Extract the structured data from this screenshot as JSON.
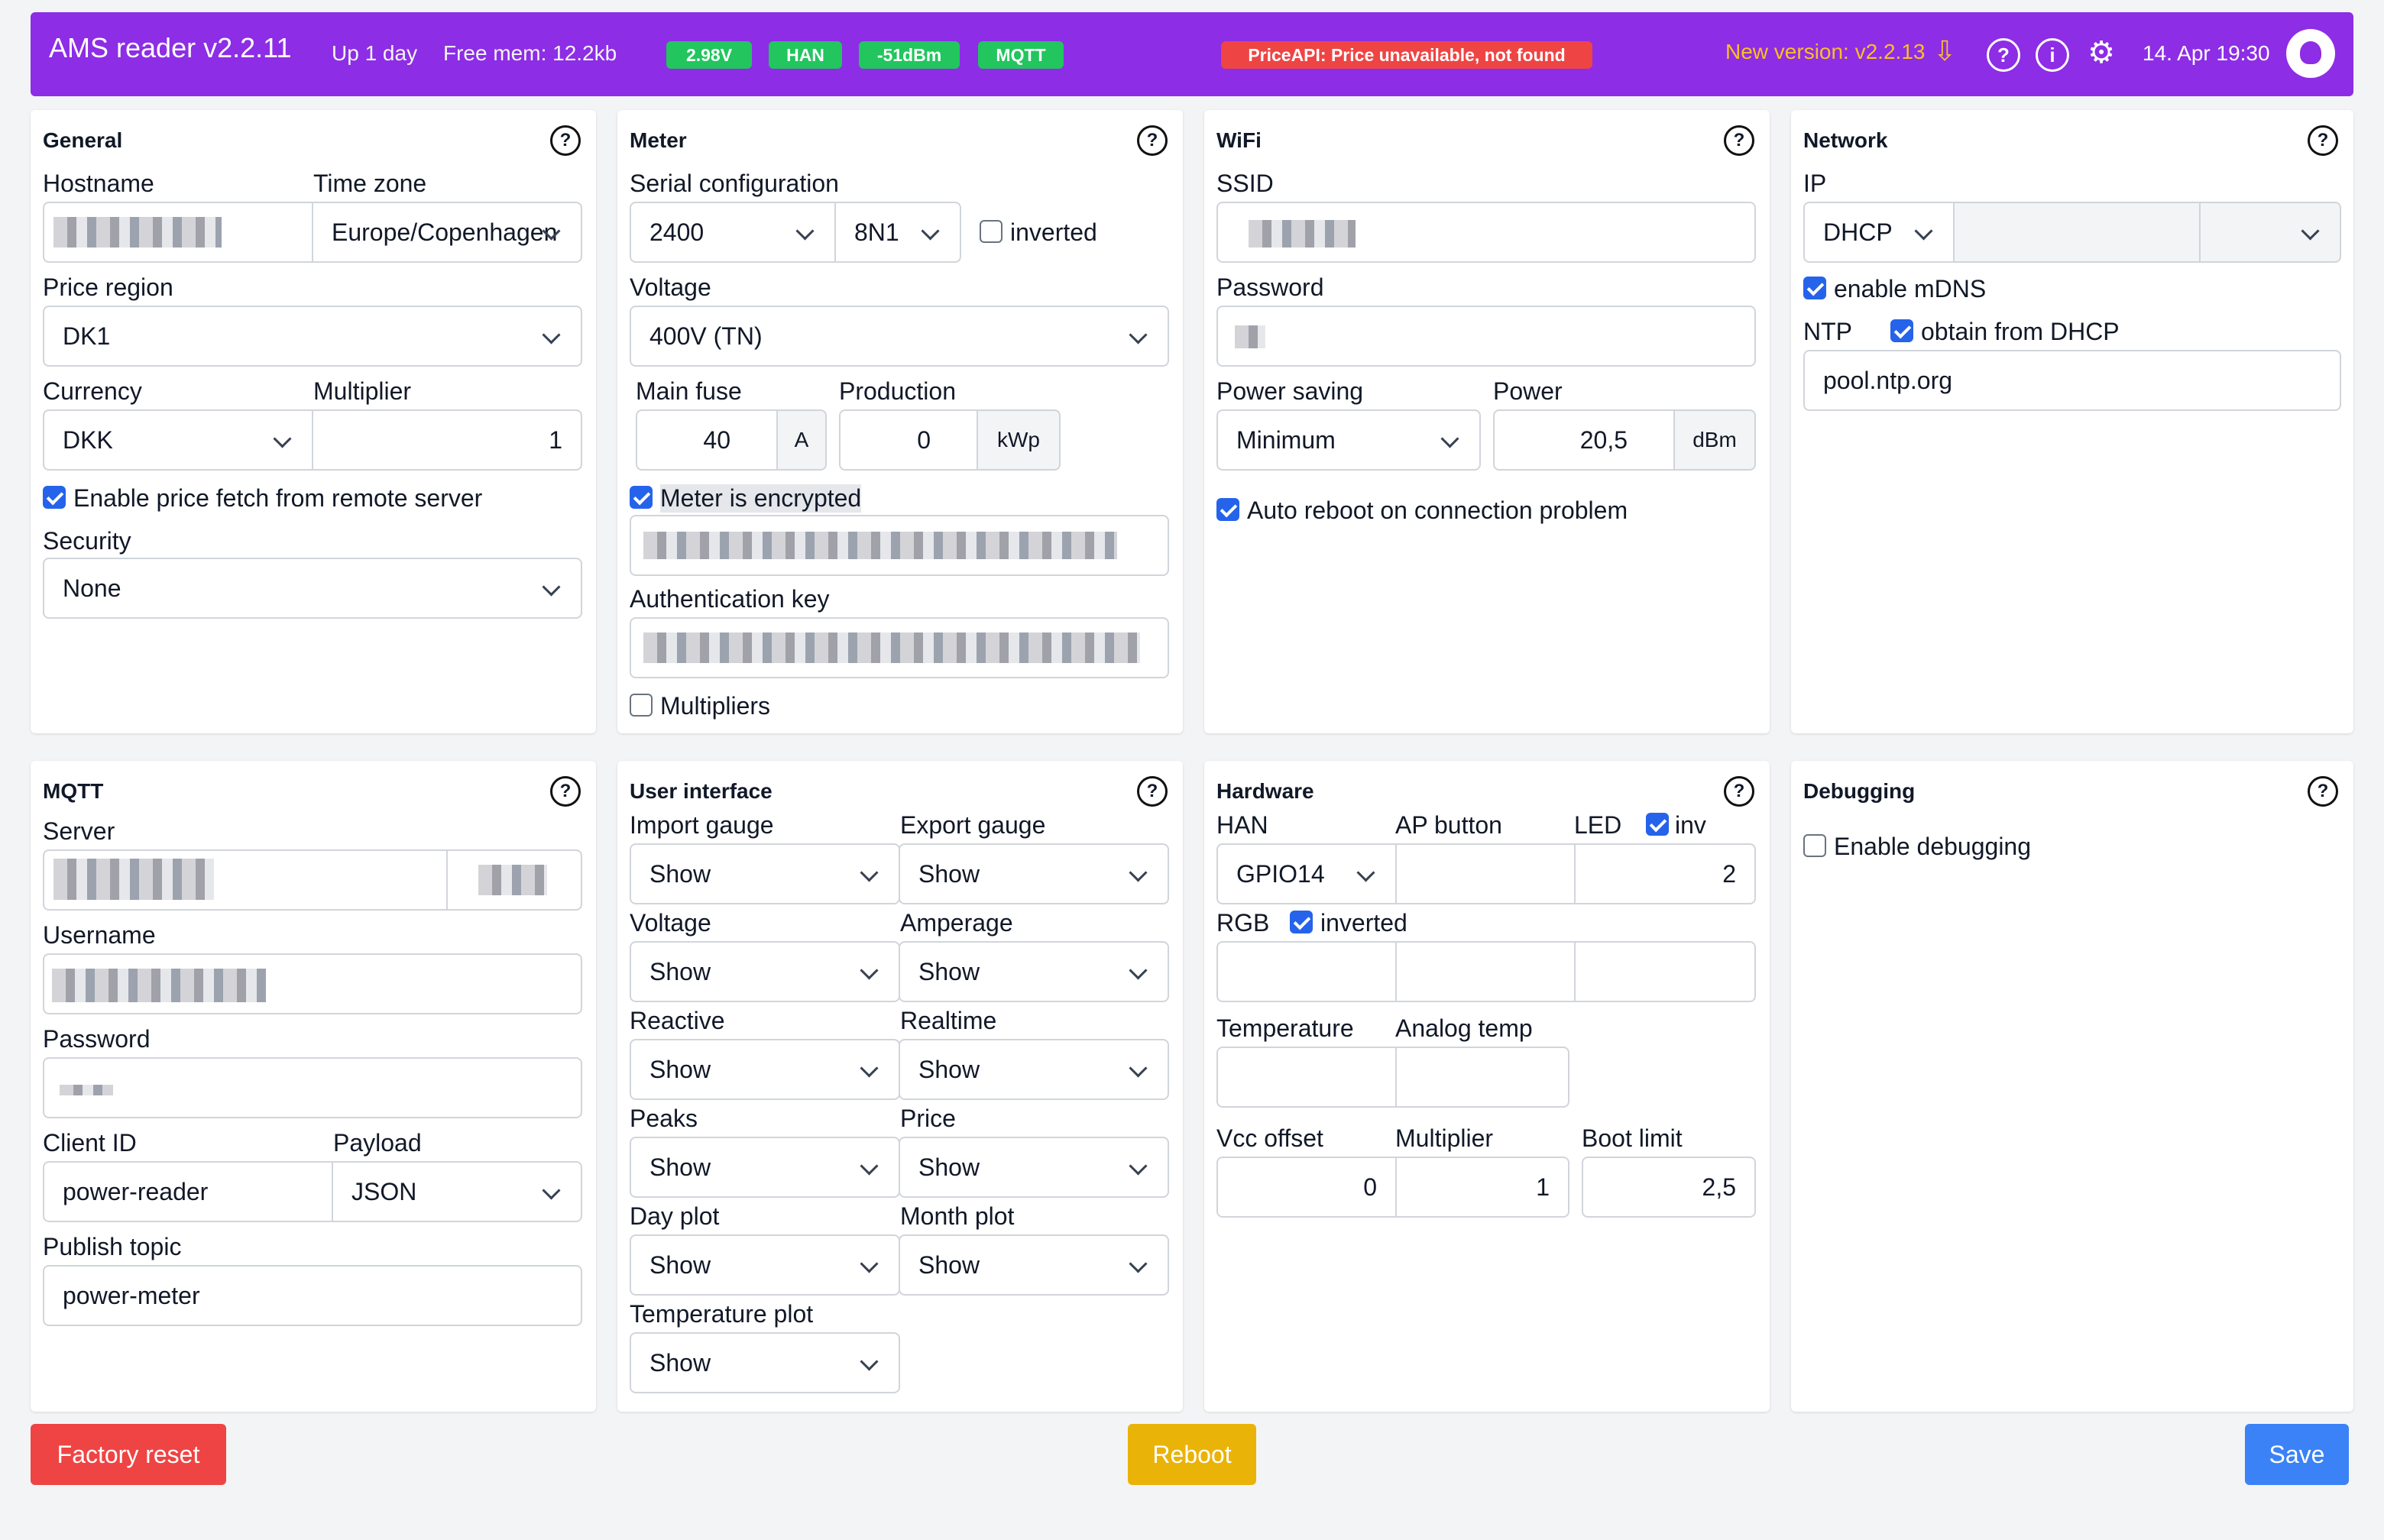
{
  "header": {
    "title": "AMS reader v2.2.11",
    "uptime": "Up 1 day",
    "free_mem": "Free mem: 12.2kb",
    "badges": [
      "2.98V",
      "HAN",
      "-51dBm",
      "MQTT"
    ],
    "error": "PriceAPI: Price unavailable, not found",
    "new_version": "New version: v2.2.13",
    "datetime": "14. Apr 19:30",
    "help_glyph": "?",
    "info_glyph": "i",
    "gear_glyph": "⚙",
    "download_glyph": "⇩",
    "colors": {
      "bar": "#8d2de5",
      "badge_ok": "#22c55e",
      "badge_err": "#ef4444",
      "new_version": "#fbbf24"
    }
  },
  "general": {
    "title": "General",
    "hostname_label": "Hostname",
    "timezone_label": "Time zone",
    "timezone": "Europe/Copenhagen",
    "price_region_label": "Price region",
    "price_region": "DK1",
    "currency_label": "Currency",
    "currency": "DKK",
    "multiplier_label": "Multiplier",
    "multiplier": "1",
    "price_fetch_label": "Enable price fetch from remote server",
    "security_label": "Security",
    "security": "None"
  },
  "meter": {
    "title": "Meter",
    "serial_label": "Serial configuration",
    "baud": "2400",
    "parity": "8N1",
    "inverted_label": "inverted",
    "voltage_label": "Voltage",
    "voltage": "400V (TN)",
    "main_fuse_label": "Main fuse",
    "main_fuse": "40",
    "main_fuse_unit": "A",
    "production_label": "Production",
    "production": "0",
    "production_unit": "kWp",
    "encrypted_label": "Meter is encrypted",
    "auth_key_label": "Authentication key",
    "multipliers_label": "Multipliers"
  },
  "wifi": {
    "title": "WiFi",
    "ssid_label": "SSID",
    "password_label": "Password",
    "power_saving_label": "Power saving",
    "power_saving": "Minimum",
    "power_label": "Power",
    "power": "20,5",
    "power_unit": "dBm",
    "auto_reboot_label": "Auto reboot on connection problem"
  },
  "network": {
    "title": "Network",
    "ip_label": "IP",
    "ip_mode": "DHCP",
    "mdns_label": "enable mDNS",
    "ntp_label": "NTP",
    "ntp_dhcp_label": "obtain from DHCP",
    "ntp_server": "pool.ntp.org"
  },
  "mqtt": {
    "title": "MQTT",
    "server_label": "Server",
    "username_label": "Username",
    "password_label": "Password",
    "client_id_label": "Client ID",
    "client_id": "power-reader",
    "payload_label": "Payload",
    "payload": "JSON",
    "topic_label": "Publish topic",
    "topic": "power-meter"
  },
  "ui": {
    "title": "User interface",
    "items": [
      {
        "label": "Import gauge",
        "value": "Show"
      },
      {
        "label": "Export gauge",
        "value": "Show"
      },
      {
        "label": "Voltage",
        "value": "Show"
      },
      {
        "label": "Amperage",
        "value": "Show"
      },
      {
        "label": "Reactive",
        "value": "Show"
      },
      {
        "label": "Realtime",
        "value": "Show"
      },
      {
        "label": "Peaks",
        "value": "Show"
      },
      {
        "label": "Price",
        "value": "Show"
      },
      {
        "label": "Day plot",
        "value": "Show"
      },
      {
        "label": "Month plot",
        "value": "Show"
      },
      {
        "label": "Temperature plot",
        "value": "Show"
      }
    ]
  },
  "hardware": {
    "title": "Hardware",
    "han_label": "HAN",
    "han": "GPIO14",
    "ap_label": "AP button",
    "led_label": "LED",
    "led_inv_label": "inv",
    "led": "2",
    "rgb_label": "RGB",
    "rgb_inv_label": "inverted",
    "temp_label": "Temperature",
    "analog_label": "Analog temp",
    "vcc_label": "Vcc offset",
    "vcc": "0",
    "mult_label": "Multiplier",
    "mult": "1",
    "boot_label": "Boot limit",
    "boot": "2,5"
  },
  "debugging": {
    "title": "Debugging",
    "enable_label": "Enable debugging"
  },
  "actions": {
    "factory_reset": "Factory reset",
    "reboot": "Reboot",
    "save": "Save",
    "colors": {
      "factory_reset": "#ef4444",
      "reboot": "#eab308",
      "save": "#3b82f6"
    }
  }
}
